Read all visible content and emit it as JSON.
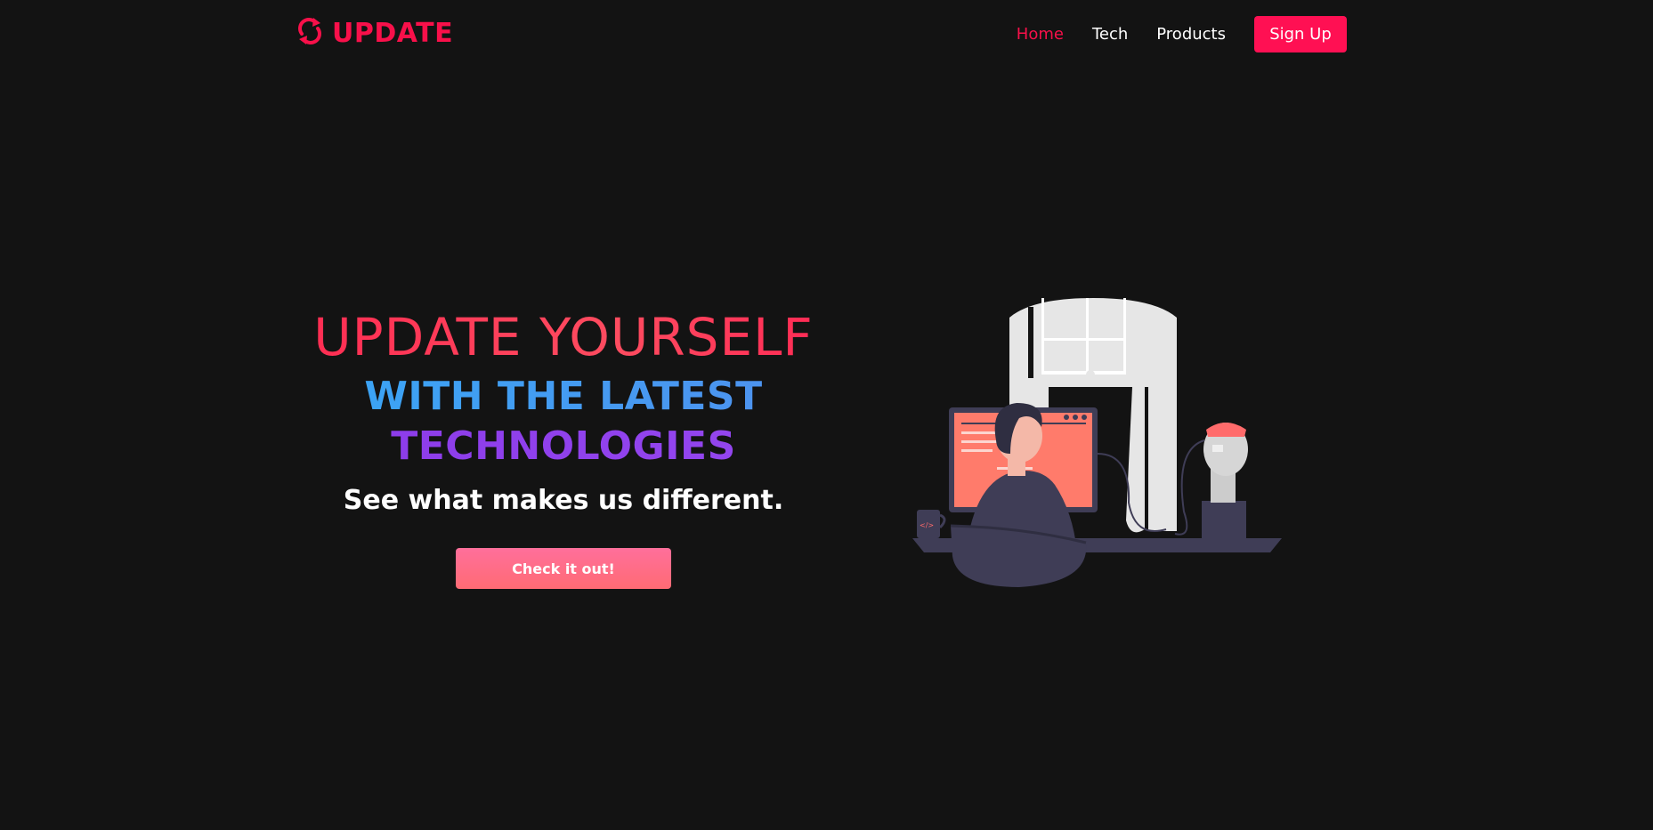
{
  "nav": {
    "logo_text": "UPDATE",
    "links": [
      {
        "label": "Home",
        "active": true
      },
      {
        "label": "Tech",
        "active": false
      },
      {
        "label": "Products",
        "active": false
      }
    ],
    "signup_label": "Sign Up"
  },
  "hero": {
    "title": "UPDATE YOURSELF",
    "subtitle_line1": "WITH THE LATEST",
    "subtitle_line2": "TECHNOLOGIES",
    "tagline": "See what makes us different.",
    "cta_label": "Check it out!"
  },
  "colors": {
    "background": "#131313",
    "brand": "#f8104a",
    "accent_blue": "#4f91ee",
    "accent_purple": "#8b3ae8",
    "cta_pink": "#ff6f9b"
  },
  "icons": {
    "logo": "sync-arrows-icon"
  }
}
